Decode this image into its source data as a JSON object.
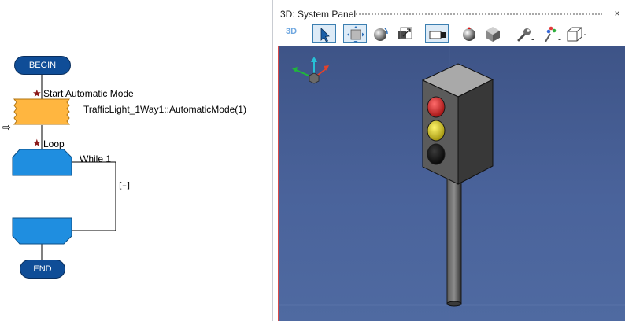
{
  "flowchart": {
    "begin_label": "BEGIN",
    "step1_comment": "Start Automatic Mode",
    "step1_call": "TrafficLight_1Way1::AutomaticMode(1)",
    "loop_comment": "Loop",
    "while_label": "While 1",
    "collapse_toggle": "[–]",
    "end_label": "END",
    "arrow_glyph": "⇨"
  },
  "panel": {
    "title": "3D: System Panel",
    "close_glyph": "×",
    "mode_label": "3D",
    "toolbar_tools": [
      "select-arrow",
      "fit-view",
      "sphere",
      "resize",
      "camera-view",
      "shaded-sphere",
      "cube",
      "wrench",
      "color-palette",
      "wireframe-box"
    ]
  },
  "colors": {
    "flow_blue": "#1f8ee0",
    "flow_orange": "#ffb640",
    "begin_end_navy": "#0f4d97",
    "selection_border": "#3c7fb1",
    "viewport_border": "#d94a4a",
    "viewport_bg": "#4a639b",
    "light_red": "#d62828",
    "light_yellow": "#e3d31a",
    "light_off": "#111111"
  }
}
